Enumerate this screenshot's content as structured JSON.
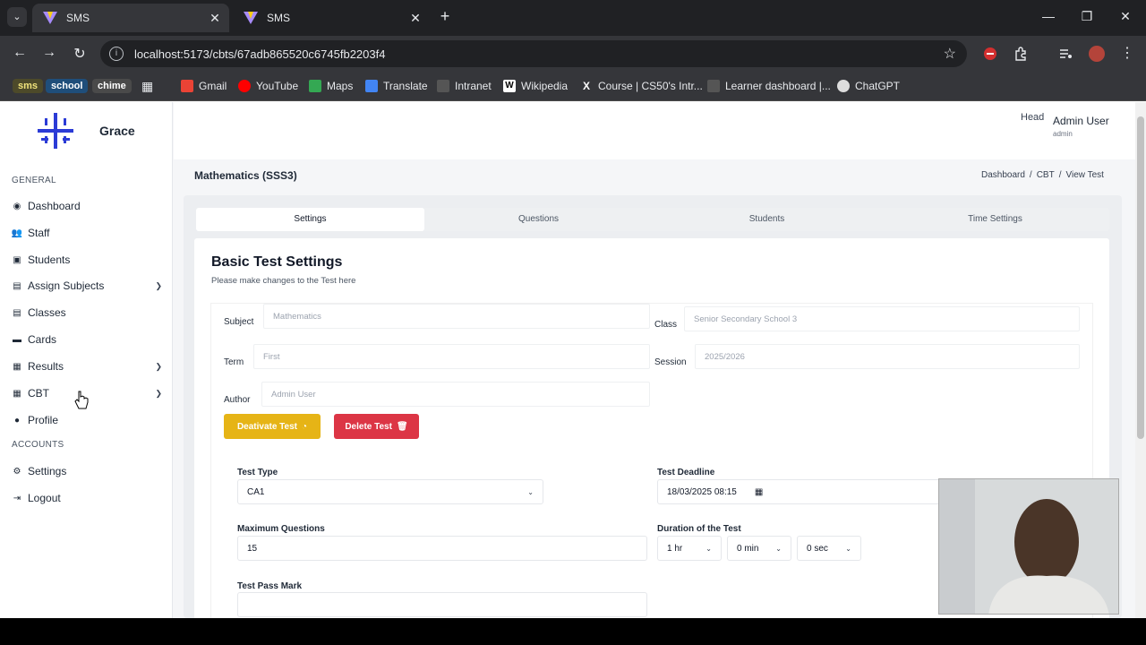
{
  "browser": {
    "tabs": [
      {
        "title": "SMS",
        "active": true
      },
      {
        "title": "SMS",
        "active": false
      }
    ],
    "new_tab": "+",
    "url": "localhost:5173/cbts/67adb865520c6745fb2203f4",
    "bookmarks": [
      "sms",
      "school",
      "chime",
      "Gmail",
      "YouTube",
      "Maps",
      "Translate",
      "Intranet",
      "Wikipedia",
      "Course | CS50's Intr...",
      "Learner dashboard |...",
      "ChatGPT"
    ]
  },
  "app": {
    "brand": "Grace",
    "user": {
      "name": "Admin User",
      "role": "admin",
      "avatar_alt": "Head"
    },
    "sidebar": {
      "general_label": "GENERAL",
      "accounts_label": "ACCOUNTS",
      "items": [
        {
          "label": "Dashboard",
          "icon": "dashboard-icon",
          "expandable": false
        },
        {
          "label": "Staff",
          "icon": "staff-icon",
          "expandable": false
        },
        {
          "label": "Students",
          "icon": "students-icon",
          "expandable": false
        },
        {
          "label": "Assign Subjects",
          "icon": "assign-icon",
          "expandable": true
        },
        {
          "label": "Classes",
          "icon": "classes-icon",
          "expandable": false
        },
        {
          "label": "Cards",
          "icon": "cards-icon",
          "expandable": false
        },
        {
          "label": "Results",
          "icon": "results-icon",
          "expandable": true
        },
        {
          "label": "CBT",
          "icon": "cbt-icon",
          "expandable": true
        },
        {
          "label": "Profile",
          "icon": "profile-icon",
          "expandable": false
        }
      ],
      "account_items": [
        {
          "label": "Settings",
          "icon": "gear-icon"
        },
        {
          "label": "Logout",
          "icon": "logout-icon"
        }
      ]
    },
    "page_title": "Mathematics (SSS3)",
    "breadcrumb": [
      "Dashboard",
      "CBT",
      "View Test"
    ],
    "tabs": [
      "Settings",
      "Questions",
      "Students",
      "Time Settings"
    ],
    "active_tab": "Settings",
    "card": {
      "title": "Basic Test Settings",
      "subtitle": "Please make changes to the Test here"
    },
    "fields": {
      "subject": {
        "label": "Subject",
        "value": "Mathematics"
      },
      "class": {
        "label": "Class",
        "value": "Senior Secondary School 3"
      },
      "term": {
        "label": "Term",
        "value": "First"
      },
      "session": {
        "label": "Session",
        "value": "2025/2026"
      },
      "author": {
        "label": "Author",
        "value": "Admin User"
      }
    },
    "buttons": {
      "deactivate": "Deativate Test",
      "delete": "Delete Test"
    },
    "settings": {
      "test_type": {
        "label": "Test Type",
        "value": "CA1"
      },
      "deadline": {
        "label": "Test Deadline",
        "value": "18/03/2025 08:15"
      },
      "max_questions": {
        "label": "Maximum Questions",
        "value": "15"
      },
      "duration": {
        "label": "Duration of the Test",
        "hours": "1 hr",
        "minutes": "0 min",
        "seconds": "0 sec"
      },
      "pass_mark": {
        "label": "Test Pass Mark"
      }
    },
    "colors": {
      "deactivate": "#e6b416",
      "delete": "#dc3545",
      "logo": "#2b3bd6"
    }
  }
}
